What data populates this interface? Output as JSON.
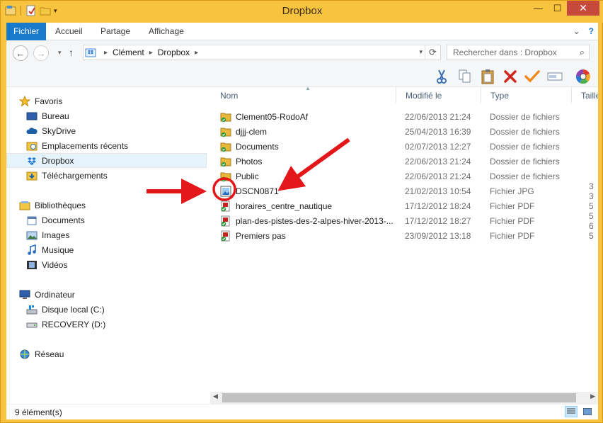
{
  "window": {
    "title": "Dropbox",
    "minimize": "—",
    "maximize": "☐",
    "close": "✕"
  },
  "ribbon": {
    "tabs": [
      {
        "label": "Fichier"
      },
      {
        "label": "Accueil"
      },
      {
        "label": "Partage"
      },
      {
        "label": "Affichage"
      }
    ],
    "expand_glyph": "⌄",
    "help_glyph": "?"
  },
  "address": {
    "back_glyph": "←",
    "forward_glyph": "→",
    "up_glyph": "↑",
    "crumbs": [
      "Clément",
      "Dropbox"
    ],
    "search_placeholder": "Rechercher dans : Dropbox"
  },
  "colors": {
    "titlebar": "#f8c33f",
    "accent": "#1979ca",
    "annotation_red": "#e3161a",
    "folder": "#e8b83c"
  },
  "nav": {
    "favorites": {
      "label": "Favoris",
      "items": [
        {
          "label": "Bureau",
          "icon": "desktop-icon"
        },
        {
          "label": "SkyDrive",
          "icon": "cloud-icon"
        },
        {
          "label": "Emplacements récents",
          "icon": "recent-places-icon"
        },
        {
          "label": "Dropbox",
          "icon": "dropbox-icon",
          "selected": true
        },
        {
          "label": "Téléchargements",
          "icon": "downloads-icon"
        }
      ]
    },
    "libraries": {
      "label": "Bibliothèques",
      "items": [
        {
          "label": "Documents",
          "icon": "documents-icon"
        },
        {
          "label": "Images",
          "icon": "pictures-icon"
        },
        {
          "label": "Musique",
          "icon": "music-icon"
        },
        {
          "label": "Vidéos",
          "icon": "videos-icon"
        }
      ]
    },
    "computer": {
      "label": "Ordinateur",
      "items": [
        {
          "label": "Disque local (C:)",
          "icon": "local-disk-icon"
        },
        {
          "label": "RECOVERY (D:)",
          "icon": "drive-icon"
        }
      ]
    },
    "network": {
      "label": "Réseau"
    }
  },
  "columns": {
    "name": "Nom",
    "modified": "Modifié le",
    "type": "Type",
    "size": "Taille"
  },
  "files": [
    {
      "name": "Clement05-RodoAf",
      "modified": "22/06/2013 21:24",
      "type": "Dossier de fichiers",
      "size": "",
      "icon": "folder-synced-icon"
    },
    {
      "name": "djjj-clem",
      "modified": "25/04/2013 16:39",
      "type": "Dossier de fichiers",
      "size": "",
      "icon": "folder-synced-icon"
    },
    {
      "name": "Documents",
      "modified": "02/07/2013 12:27",
      "type": "Dossier de fichiers",
      "size": "",
      "icon": "folder-synced-icon"
    },
    {
      "name": "Photos",
      "modified": "22/06/2013 21:24",
      "type": "Dossier de fichiers",
      "size": "",
      "icon": "folder-synced-icon"
    },
    {
      "name": "Public",
      "modified": "22/06/2013 21:24",
      "type": "Dossier de fichiers",
      "size": "",
      "icon": "folder-synced-icon"
    },
    {
      "name": "DSCN0871",
      "modified": "21/02/2013 10:54",
      "type": "Fichier JPG",
      "size": "3 3",
      "icon": "image-file-icon"
    },
    {
      "name": "horaires_centre_nautique",
      "modified": "17/12/2012 18:24",
      "type": "Fichier PDF",
      "size": "5",
      "icon": "pdf-file-icon"
    },
    {
      "name": "plan-des-pistes-des-2-alpes-hiver-2013-...",
      "modified": "17/12/2012 18:27",
      "type": "Fichier PDF",
      "size": "5 6",
      "icon": "pdf-file-icon"
    },
    {
      "name": "Premiers pas",
      "modified": "23/09/2012 13:18",
      "type": "Fichier PDF",
      "size": "5",
      "icon": "pdf-file-icon"
    }
  ],
  "status": {
    "count": "9 élément(s)"
  }
}
